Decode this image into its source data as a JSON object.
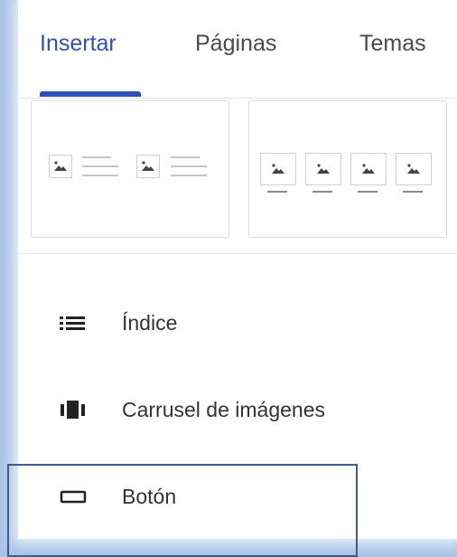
{
  "tabs": [
    {
      "label": "Insertar",
      "active": true
    },
    {
      "label": "Páginas",
      "active": false
    },
    {
      "label": "Temas",
      "active": false
    }
  ],
  "layouts": [
    {
      "name": "two-images-with-text",
      "image_count": 2
    },
    {
      "name": "four-images-with-captions",
      "image_count": 4
    }
  ],
  "menu": [
    {
      "label": "Índice",
      "icon": "list-icon"
    },
    {
      "label": "Carrusel de imágenes",
      "icon": "carousel-icon"
    },
    {
      "label": "Botón",
      "icon": "button-icon"
    }
  ],
  "colors": {
    "accent": "#2d4fb8",
    "active_tab": "#3450b0",
    "background": "#a9c3e6",
    "highlight_border": "#3d5d85"
  }
}
